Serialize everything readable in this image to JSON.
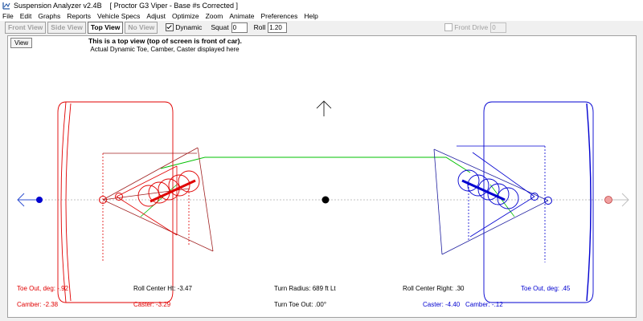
{
  "window": {
    "title": "Suspension Analyzer v2.4B    [ Proctor G3 Viper - Base #s Corrected ]"
  },
  "menu": [
    "File",
    "Edit",
    "Graphs",
    "Reports",
    "Vehicle Specs",
    "Adjust",
    "Optimize",
    "Zoom",
    "Animate",
    "Preferences",
    "Help"
  ],
  "toolbar": {
    "tabs": {
      "front": "Front View",
      "side": "Side View",
      "top": "Top View",
      "none": "No View"
    },
    "dynamic_label": "Dynamic",
    "squat_label": "Squat",
    "squat_value": "0",
    "roll_label": "Roll",
    "roll_value": "1.20",
    "front_drive_label": "Front Drive",
    "front_drive_value": "0"
  },
  "canvas": {
    "view_button": "View",
    "header_line1": "This is a top view (top of screen is front of car).",
    "header_line2": "Actual Dynamic Toe, Camber, Caster displayed here"
  },
  "readouts": {
    "toe_left": "Toe Out, deg: -.92",
    "camber_left": "Camber: -2.38",
    "roll_center_ht": "Roll Center Ht: -3.47",
    "caster_left": "Caster: -3.29",
    "turn_radius": "Turn Radius: 689 ft Lt",
    "turn_toe_out": "Turn Toe Out: .00°",
    "roll_center_right": "Roll Center Right: .30",
    "caster_right": "Caster: -4.40",
    "toe_right": "Toe Out, deg: .45",
    "camber_right": "Camber: -.12"
  },
  "colors": {
    "left": "#e00000",
    "right": "#0000d0",
    "tierod": "#00c000",
    "left_light": "#f07070",
    "right_light": "#7070e0"
  }
}
